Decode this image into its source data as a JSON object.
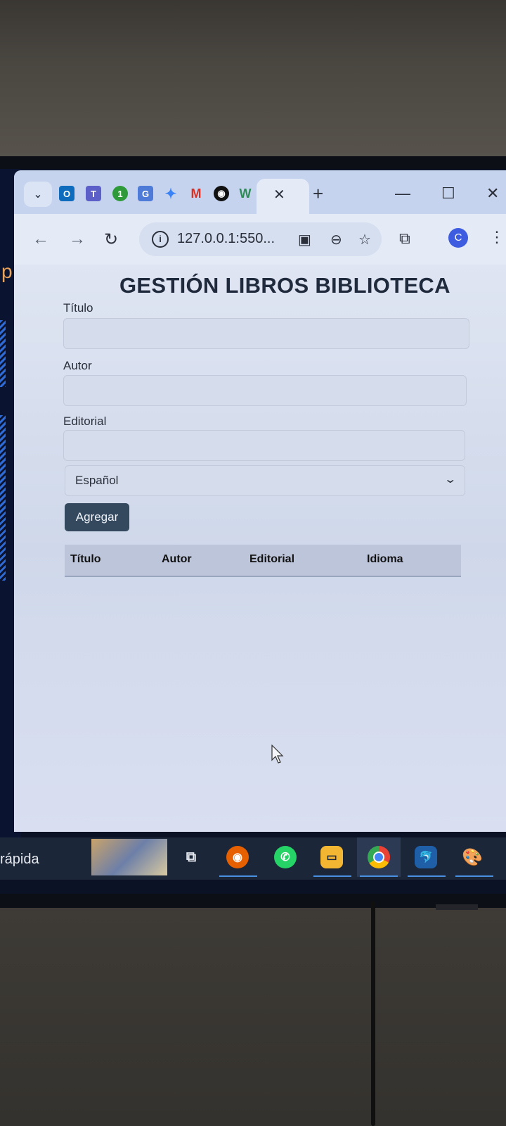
{
  "browser": {
    "tabs": [
      {
        "icon": "outlook-icon",
        "glyph": "O",
        "color": "#0f6cbd"
      },
      {
        "icon": "teams-icon",
        "glyph": "T",
        "color": "#5b5fc7"
      },
      {
        "icon": "onenote-1-icon",
        "glyph": "1",
        "color": "#2e9a3a"
      },
      {
        "icon": "translate-icon",
        "glyph": "G",
        "color": "#4f7bd8"
      },
      {
        "icon": "gemini-icon",
        "glyph": "✦",
        "color": "#3b82f6"
      },
      {
        "icon": "gmail-icon",
        "glyph": "M",
        "color": "#d93025"
      },
      {
        "icon": "github-icon",
        "glyph": "●",
        "color": "#111111"
      },
      {
        "icon": "w-icon",
        "glyph": "W",
        "color": "#2e8b57"
      }
    ],
    "url": "127.0.0.1:550..."
  },
  "page": {
    "title": "GESTIÓN LIBROS BIBLIOTECA",
    "fields": {
      "titulo_label": "Título",
      "autor_label": "Autor",
      "editorial_label": "Editorial"
    },
    "language_select": "Español",
    "add_button": "Agregar",
    "table_headers": [
      "Título",
      "Autor",
      "Editorial",
      "Idioma"
    ]
  },
  "taskbar": {
    "search_text": "rápida",
    "apps": [
      "task-view-icon",
      "firefox-icon",
      "whatsapp-icon",
      "file-explorer-icon",
      "chrome-icon",
      "mysql-workbench-icon",
      "paint-icon"
    ]
  },
  "colors": {
    "page_bg": "#d6ddee",
    "button_bg": "#34495e",
    "table_header_bg": "#bcc5da"
  }
}
